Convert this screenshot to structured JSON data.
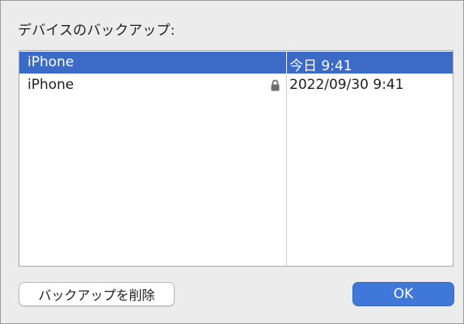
{
  "dialog": {
    "title": "デバイスのバックアップ:"
  },
  "backups": [
    {
      "name": "iPhone",
      "date": "今日 9:41",
      "selected": true,
      "locked": false
    },
    {
      "name": "iPhone",
      "date": "2022/09/30 9:41",
      "selected": false,
      "locked": true,
      "lock_icon": "lock-icon"
    }
  ],
  "buttons": {
    "delete_label": "バックアップを削除",
    "ok_label": "OK"
  },
  "colors": {
    "selection": "#3c6bc7",
    "primary_button": "#3f78d8"
  }
}
